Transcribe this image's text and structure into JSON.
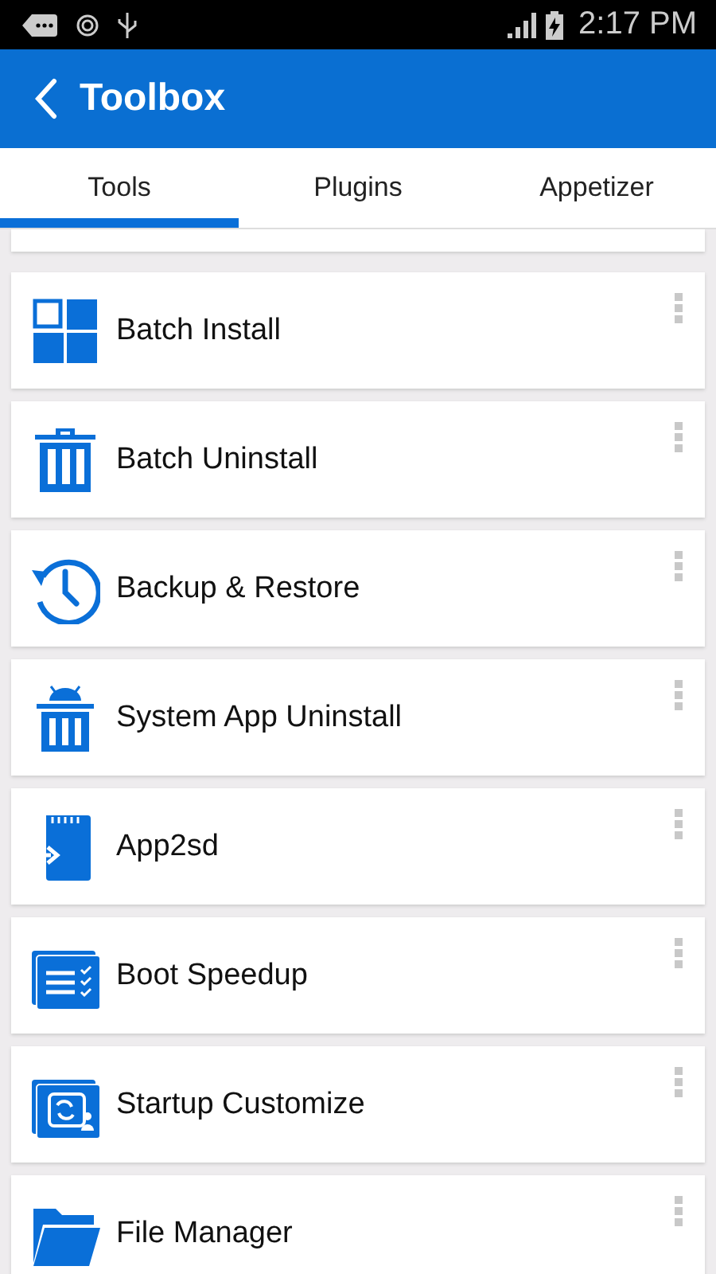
{
  "status_bar": {
    "time": "2:17 PM"
  },
  "app_bar": {
    "title": "Toolbox"
  },
  "tabs": [
    {
      "label": "Tools",
      "selected": true
    },
    {
      "label": "Plugins",
      "selected": false
    },
    {
      "label": "Appetizer",
      "selected": false
    }
  ],
  "tools": [
    {
      "label": "Batch Install",
      "kind": "grid"
    },
    {
      "label": "Batch Uninstall",
      "kind": "trash"
    },
    {
      "label": "Backup & Restore",
      "kind": "history"
    },
    {
      "label": "System App Uninstall",
      "kind": "robot-trash"
    },
    {
      "label": "App2sd",
      "kind": "sdcard"
    },
    {
      "label": "Boot Speedup",
      "kind": "checklist"
    },
    {
      "label": "Startup Customize",
      "kind": "sync"
    },
    {
      "label": "File Manager",
      "kind": "folder"
    }
  ]
}
